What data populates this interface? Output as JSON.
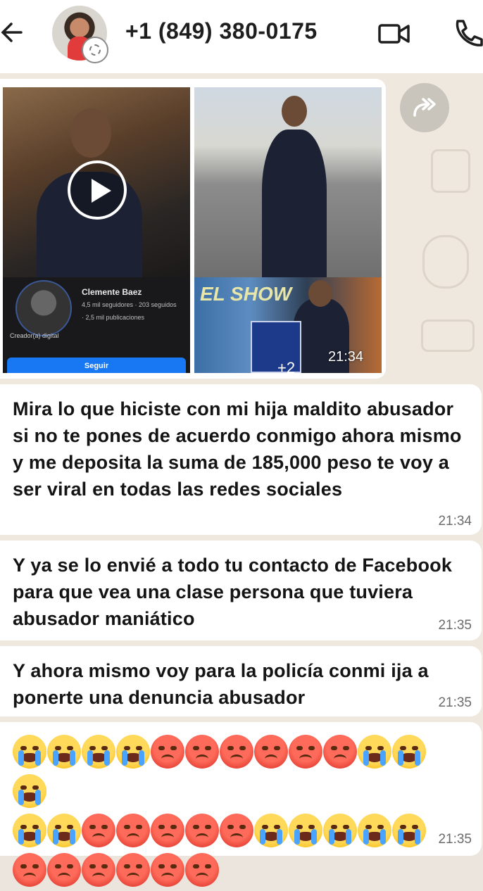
{
  "header": {
    "contact_name": "+1 (849) 380-0175",
    "back_icon": "arrow-left-icon",
    "video_icon": "video-camera-icon",
    "call_icon": "phone-icon"
  },
  "media_message": {
    "profile": {
      "name": "Clemente Baez",
      "stats": "4,5 mil seguidores · 203 seguidos",
      "posts": "· 2,5 mil publicaciones",
      "role": "Creador(a) digital",
      "follow_label": "Seguir"
    },
    "show_text": "EL SHOW",
    "extra_count": "+2",
    "time": "21:34"
  },
  "messages": [
    {
      "text": "Mira lo que hiciste con mi hija maldito abusador si no te pones de acuerdo conmigo ahora mismo y me deposita la suma de 185,000 peso te voy a ser viral en todas las redes sociales",
      "time": "21:34"
    },
    {
      "text": "Y ya se lo envié a todo tu contacto de Facebook para que vea una clase persona que tuviera abusador maniático",
      "time": "21:35"
    },
    {
      "text": "Y ahora mismo voy para la policía conmi ija a ponerte una denuncia abusador",
      "time": "21:35"
    }
  ],
  "emoji_message": {
    "rows": [
      [
        "cry",
        "cry",
        "cry",
        "cry",
        "angry",
        "angry",
        "angry",
        "angry",
        "angry",
        "angry",
        "cry",
        "cry",
        "cry"
      ],
      [
        "cry",
        "cry",
        "angry",
        "angry",
        "angry",
        "angry",
        "angry",
        "cry",
        "cry",
        "cry",
        "cry",
        "cry"
      ],
      [
        "angry",
        "angry",
        "angry",
        "angry",
        "angry",
        "angry"
      ]
    ],
    "time": "21:35"
  },
  "colors": {
    "chat_background": "#efe8df",
    "bubble": "#ffffff",
    "header": "#ffffff"
  }
}
